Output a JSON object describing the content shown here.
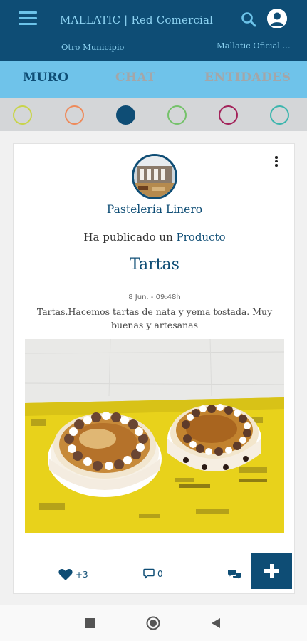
{
  "app": {
    "title": "MALLATIC | Red Comercial",
    "municipality": "Otro Municipio",
    "official": "Mallatic Oficial ..."
  },
  "tabs": [
    {
      "label": "MURO",
      "active": true
    },
    {
      "label": "CHAT",
      "active": false
    },
    {
      "label": "ENTIDADES",
      "active": false
    }
  ],
  "filters": {
    "colors": [
      "#c8d44a",
      "#ee8a5a",
      "#0e4d75",
      "#75c26b",
      "#a3235a",
      "#3bb5ad"
    ],
    "selected_index": 2
  },
  "post": {
    "entity_name": "Pastelería Linero",
    "published_prefix": "Ha publicado un",
    "published_type": "Producto",
    "title": "Tartas",
    "date": "8 Jun. - 09:48h",
    "description": "Tartas.Hacemos tartas de nata y yema tostada. Muy buenas y artesanas",
    "likes": "+3",
    "comments": "0"
  },
  "icons": {
    "menu": "hamburger-icon",
    "search": "search-icon",
    "account": "account-icon",
    "more": "more-vertical-icon",
    "like": "heart-icon",
    "comment": "comment-icon",
    "chat": "chat-bubbles-icon",
    "add": "plus-icon",
    "nav_recents": "square-icon",
    "nav_home": "circle-icon",
    "nav_back": "back-triangle-icon"
  },
  "colors": {
    "primary": "#0e4d75",
    "accent": "#6fc3ea",
    "header_text": "#8dd3f2"
  }
}
